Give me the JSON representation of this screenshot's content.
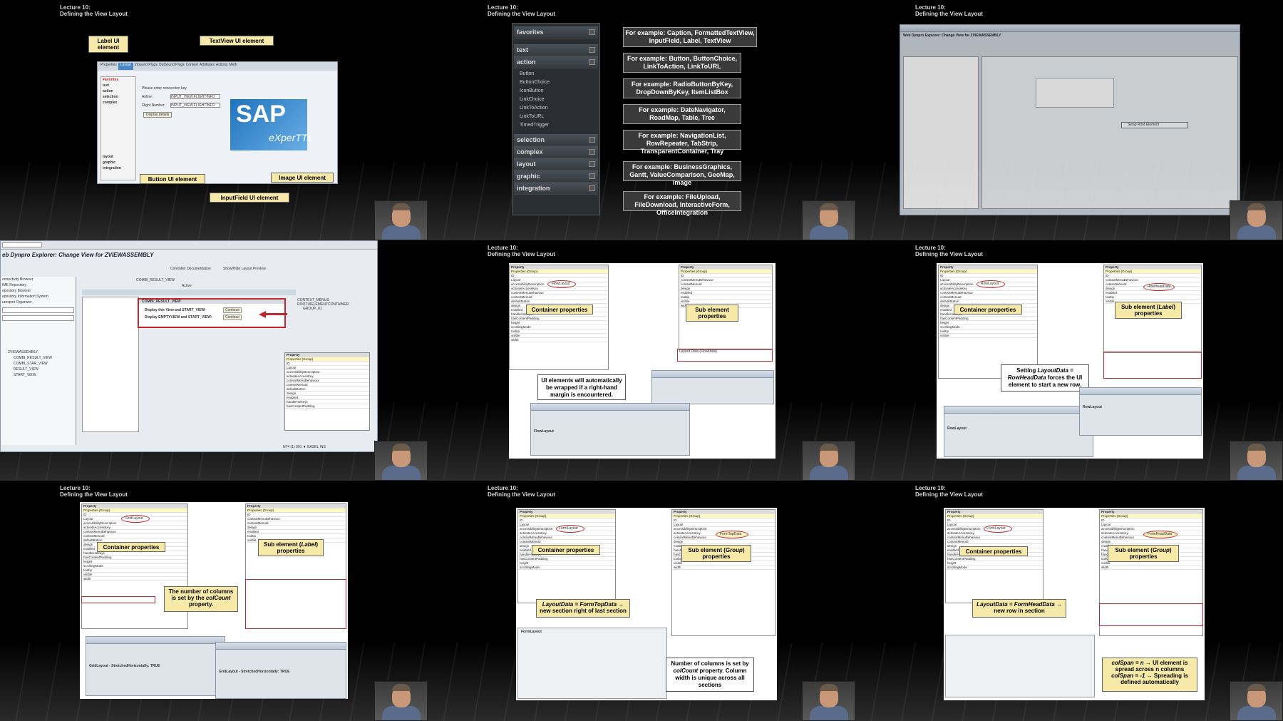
{
  "lecture_header": {
    "line1": "Lecture 10:",
    "line2": "Defining the View Layout"
  },
  "cell1": {
    "callouts": {
      "label": "Label UI element",
      "textview": "TextView UI element",
      "button": "Button UI element",
      "inputfield": "InputField UI element",
      "image": "Image UI element"
    },
    "tabs": [
      "Properties",
      "Layout",
      "Inbound Plugs",
      "Outbound Plugs",
      "Context",
      "Attributes",
      "Actions",
      "Meth"
    ],
    "categories": [
      "Favorites",
      "text",
      "action",
      "selection",
      "complex",
      "layout",
      "graphic",
      "integration"
    ],
    "form": {
      "hint": "Please enter connection key",
      "airline_label": "Airline:",
      "airline_value": "INPUT_VIEW.FLIGHTINFO",
      "flight_label": "Flight Number:",
      "flight_value": "INPUT_VIEW.FLIGHTINFO",
      "display_button": "Display details"
    },
    "logo": {
      "main": "SAP",
      "sub": "eXperTTs"
    }
  },
  "cell2": {
    "categories": [
      "favorites",
      "text",
      "action",
      "selection",
      "complex",
      "layout",
      "graphic",
      "integration"
    ],
    "action_items": [
      "Button",
      "ButtonChoice",
      "IconButton",
      "LinkChoice",
      "LinkToAction",
      "LinkToURL",
      "TimedTrigger"
    ],
    "examples": [
      "For example: Caption, FormattedTextView, InputField, Label, TextView",
      "For example: Button, ButtonChoice, LinkToAction, LinkToURL",
      "For example: RadioButtonByKey, DropDownByKey, ItemListBox",
      "For example: DateNavigator, RoadMap, Table, Tree",
      "For example: NavigationList, RowRepeater, TabStrip, TransparentContainer, Tray",
      "For example: BusinessGraphics, Gantt, ValueComparison, GeoMap, Image",
      "For example: FileUpload, FileDownload, InteractiveForm, OfficeIntegration"
    ]
  },
  "cell3": {
    "title": "Web Dynpro Explorer: Change View for ZVIEWASSEMBLY",
    "menu_item": "Swap Root Element"
  },
  "cell4": {
    "title": "eb Dynpro Explorer: Change View for ZVIEWASSEMBLY",
    "view_name": "COMBI_RESULT_VIEW",
    "status": "Active",
    "text1": "Display this View and START_VIEW:",
    "text2": "Display EMPTYVIEW and START_VIEW:",
    "continue": "Continue",
    "controller_doc": "Controller Documentation",
    "show_hide": "Show/Hide Layout Preview",
    "tree_items": [
      "CONTEXT_MENUS",
      "ROOTUIELEMENTCONTAINER",
      "GROUP_01"
    ],
    "left_tree": [
      "onnectivity Browser",
      "IME Repository",
      "epository Browser",
      "epository Information System",
      "ransport Organizer",
      "ZVIEWASSEMBLY",
      "COMBI_RESULT_VIEW",
      "COMBI_STAR_VIEW",
      "RESULT_VIEW",
      "START_VIEW"
    ],
    "statusbar": "N74 (1) 001 ▼ BASEL INS"
  },
  "cell5": {
    "container_props": "Container properties",
    "sub_props": "Sub element properties",
    "note": "UI elements will automatically be wrapped if a right-hand margin is encountered.",
    "layout_value": "FlowLayout",
    "layout_data": "Layout Data (FlowData)",
    "preview_title": "FlowLayout"
  },
  "cell6": {
    "container_props": "Container properties",
    "sub_props_pre": "Sub element (",
    "sub_props_em": "Label",
    "sub_props_post": ") properties",
    "note_pre": "Setting ",
    "note_em1": "LayoutData",
    "note_mid": " = ",
    "note_em2": "RowHeadData",
    "note_post": " forces the UI element to start a new row.",
    "layout_value": "RowLayout",
    "layoutdata_value": "RowHeadData",
    "preview_title": "RowLayout"
  },
  "cell7": {
    "container_props": "Container properties",
    "sub_props_pre": "Sub element (",
    "sub_props_em": "Label",
    "sub_props_post": ") properties",
    "note_pre": "The number of columns is set by the ",
    "note_em": "colCount",
    "note_post": " property.",
    "layout_value": "GridLayout",
    "preview1": "GridLayout - StretchedHorizontally: TRUE",
    "preview2": "GridLayout - StretchedHorizontally: TRUE"
  },
  "cell8": {
    "container_props": "Container properties",
    "sub_props_pre": "Sub element (",
    "sub_props_em": "Group",
    "sub_props_post": ") properties",
    "note1_em": "LayoutData = FormTopData",
    "note1_post": " → new section right of last section",
    "note2_pre": "Number of columns is set by ",
    "note2_em": "colCount",
    "note2_post": " property. Column width is unique across all sections",
    "layout_value": "FormLayout",
    "layoutdata_value": "FormTopData",
    "preview_title": "FormLayout"
  },
  "cell9": {
    "container_props": "Container properties",
    "sub_props_pre": "Sub element (",
    "sub_props_em": "Group",
    "sub_props_post": ") properties",
    "note1_em": "LayoutData = FormHeadData",
    "note1_post": " → new row in section",
    "note2_a": "colSpan = n",
    "note2_b": " → UI element is spread across n columns",
    "note2_c": "colSpan = -1",
    "note2_d": " → Spreading is defined automatically",
    "layout_value": "FormLayout",
    "layoutdata_value": "FormHeadData"
  },
  "prop_table": {
    "headers": [
      "Property",
      "Value",
      "Binding"
    ],
    "rows": [
      "Properties (Group)",
      "ID",
      "Layout",
      "accessibilityDescription",
      "activateAccessKey",
      "contextMenuBehaviour",
      "contextMenuId",
      "defaultButton",
      "design",
      "enabled",
      "handleHotkeys",
      "hasContentPadding",
      "height",
      "scrollingMode",
      "tooltip",
      "visible",
      "width"
    ]
  },
  "colors": {
    "callout": "#f7e9a8",
    "highlight": "#c0282d",
    "panel": "#2a2e33"
  }
}
